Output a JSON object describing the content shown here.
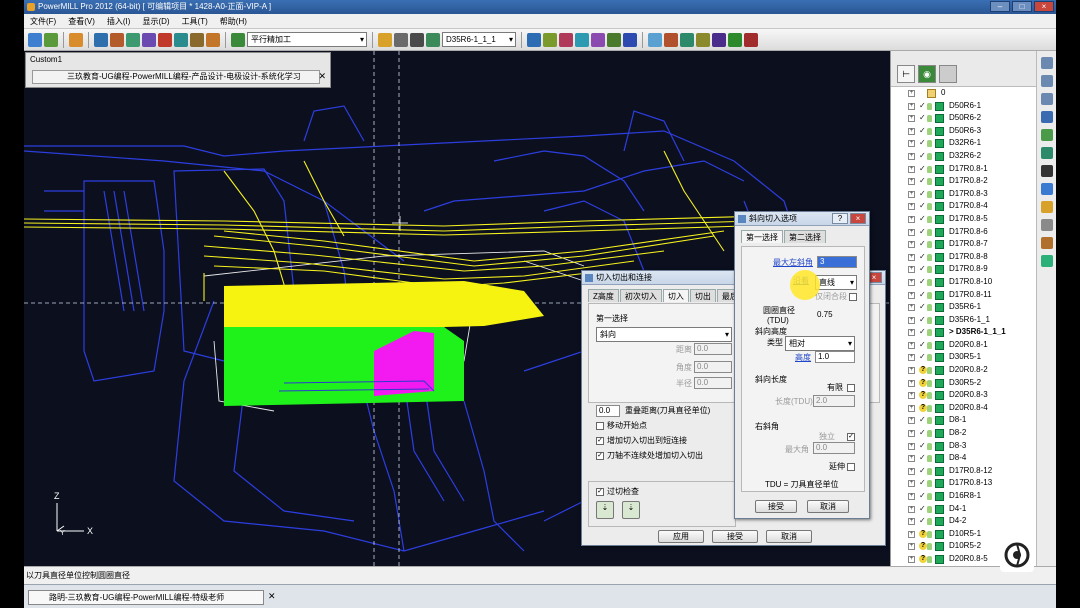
{
  "window": {
    "title": "PowerMILL Pro 2012 (64-bit)   [ 可编辑项目 * 1428-A0-正面-VIP-A ]"
  },
  "menu": [
    "文件(F)",
    "查看(V)",
    "插入(I)",
    "显示(D)",
    "工具(T)",
    "帮助(H)"
  ],
  "toolbar": {
    "strategy_combo": "平行精加工",
    "tool_combo": "D35R6-1_1_1"
  },
  "custom_panel": {
    "title": "Custom1",
    "tab_label": "三玖教育-UG编程-PowerMILL编程-产品设计-电极设计-系统化学习"
  },
  "axes": {
    "z": "Z",
    "y": "Y",
    "x": "X"
  },
  "explorer": {
    "tree": [
      {
        "label": "0",
        "kind": "folder"
      },
      {
        "label": "D50R6-1",
        "kind": "ok"
      },
      {
        "label": "D50R6-2",
        "kind": "ok"
      },
      {
        "label": "D50R6-3",
        "kind": "ok"
      },
      {
        "label": "D32R6-1",
        "kind": "ok"
      },
      {
        "label": "D32R6-2",
        "kind": "ok"
      },
      {
        "label": "D17R0.8-1",
        "kind": "ok"
      },
      {
        "label": "D17R0.8-2",
        "kind": "ok"
      },
      {
        "label": "D17R0.8-3",
        "kind": "ok"
      },
      {
        "label": "D17R0.8-4",
        "kind": "ok"
      },
      {
        "label": "D17R0.8-5",
        "kind": "ok"
      },
      {
        "label": "D17R0.8-6",
        "kind": "ok"
      },
      {
        "label": "D17R0.8-7",
        "kind": "ok"
      },
      {
        "label": "D17R0.8-8",
        "kind": "ok"
      },
      {
        "label": "D17R0.8-9",
        "kind": "ok"
      },
      {
        "label": "D17R0.8-10",
        "kind": "ok"
      },
      {
        "label": "D17R0.8-11",
        "kind": "ok"
      },
      {
        "label": "D35R6-1",
        "kind": "ok"
      },
      {
        "label": "D35R6-1_1",
        "kind": "ok"
      },
      {
        "label": "> D35R6-1_1_1",
        "kind": "active"
      },
      {
        "label": "D20R0.8-1",
        "kind": "ok"
      },
      {
        "label": "D30R5-1",
        "kind": "ok"
      },
      {
        "label": "D20R0.8-2",
        "kind": "q"
      },
      {
        "label": "D30R5-2",
        "kind": "q"
      },
      {
        "label": "D20R0.8-3",
        "kind": "q"
      },
      {
        "label": "D20R0.8-4",
        "kind": "q"
      },
      {
        "label": "D8-1",
        "kind": "ok"
      },
      {
        "label": "D8-2",
        "kind": "ok"
      },
      {
        "label": "D8-3",
        "kind": "ok"
      },
      {
        "label": "D8-4",
        "kind": "ok"
      },
      {
        "label": "D17R0.8-12",
        "kind": "ok"
      },
      {
        "label": "D17R0.8-13",
        "kind": "ok"
      },
      {
        "label": "D16R8-1",
        "kind": "ok"
      },
      {
        "label": "D4-1",
        "kind": "ok"
      },
      {
        "label": "D4-2",
        "kind": "ok"
      },
      {
        "label": "D10R5-1",
        "kind": "q"
      },
      {
        "label": "D10R5-2",
        "kind": "q"
      },
      {
        "label": "D20R0.8-5",
        "kind": "q"
      }
    ]
  },
  "dlg_leadin": {
    "title": "切入切出和连接",
    "tabs": [
      "Z高度",
      "初次切入",
      "切入",
      "切出",
      "最后"
    ],
    "first_choice_label": "第一选择",
    "type_value": "斜向",
    "distance_label": "距离",
    "distance_value": "0.0",
    "angle_label": "角度",
    "angle_value": "0.0",
    "radius_label": "半径",
    "radius_value": "0.0",
    "overlap_value": "0.0",
    "overlap_label": "重叠距离(刀具直径单位)",
    "move_start_label": "移动开始点",
    "add_leadin_label": "增加切入切出到短连接",
    "add_discontinuous_label": "刀轴不连续处增加切入切出",
    "gouge_check_label": "过切检查",
    "btn_apply": "应用",
    "btn_accept": "接受",
    "btn_cancel": "取消"
  },
  "dlg_ramp": {
    "title": "斜向切入选项",
    "tabs": [
      "第一选择",
      "第二选择"
    ],
    "max_angle_label": "最大左斜角",
    "max_angle_value": "3",
    "follow_label": "沿着",
    "follow_value": "直线",
    "closed_only_label": "仅闭合段",
    "circle_dia_label": "圆圈直径",
    "circle_dia_unit": "(TDU)",
    "circle_dia_value": "0.75",
    "ramp_height_label": "斜向高度",
    "type_label": "类型",
    "type_value": "相对",
    "height_label": "高度",
    "height_value": "1.0",
    "ramp_length_label": "斜向长度",
    "finite_label": "有限",
    "length_label": "长度(TDU)",
    "length_value": "2.0",
    "right_angle_label": "右斜角",
    "independent_label": "独立",
    "max_angle2_label": "最大角",
    "max_angle2_value": "0.0",
    "extend_label": "延伸",
    "tdu_note": "TDU = 刀具直径单位",
    "btn_accept": "接受",
    "btn_cancel": "取消"
  },
  "status": {
    "text": "以刀具直径单位控制圆圈直径"
  },
  "taskbar": {
    "chip": "路明-三玖教育-UG编程-PowerMILL编程-特级老师"
  }
}
